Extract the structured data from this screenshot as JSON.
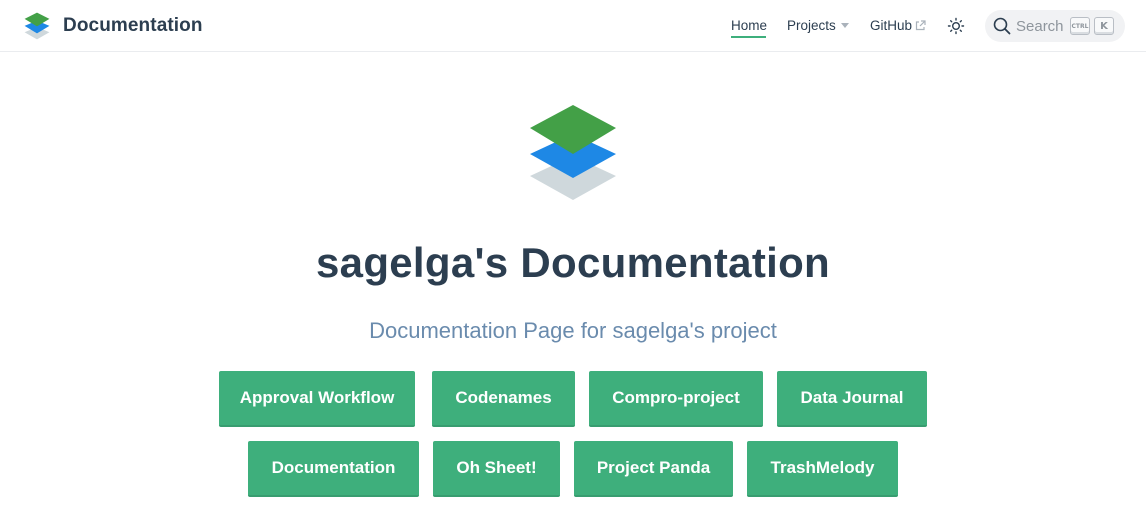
{
  "navbar": {
    "brand_title": "Documentation",
    "links": {
      "home": "Home",
      "projects": "Projects",
      "github": "GitHub"
    },
    "search": {
      "placeholder": "Search",
      "shortcut_ctrl": "CTRL",
      "shortcut_key": "K"
    }
  },
  "hero": {
    "title": "sagelga's Documentation",
    "description": "Documentation Page for sagelga's project",
    "actions": [
      "Approval Workflow",
      "Codenames",
      "Compro-project",
      "Data Journal",
      "Documentation",
      "Oh Sheet!",
      "Project Panda",
      "TrashMelody"
    ]
  },
  "colors": {
    "accent": "#3eaf7c",
    "text": "#2c3e50",
    "description": "#6a8bad",
    "logo_green": "#43a047",
    "logo_blue": "#1e88e5",
    "logo_gray": "#cfd8dc"
  },
  "icons": {
    "brand": "layers-logo-icon",
    "external_link": "external-link-icon",
    "theme_toggle": "sun-icon",
    "search": "search-icon",
    "dropdown": "caret-down-icon"
  }
}
